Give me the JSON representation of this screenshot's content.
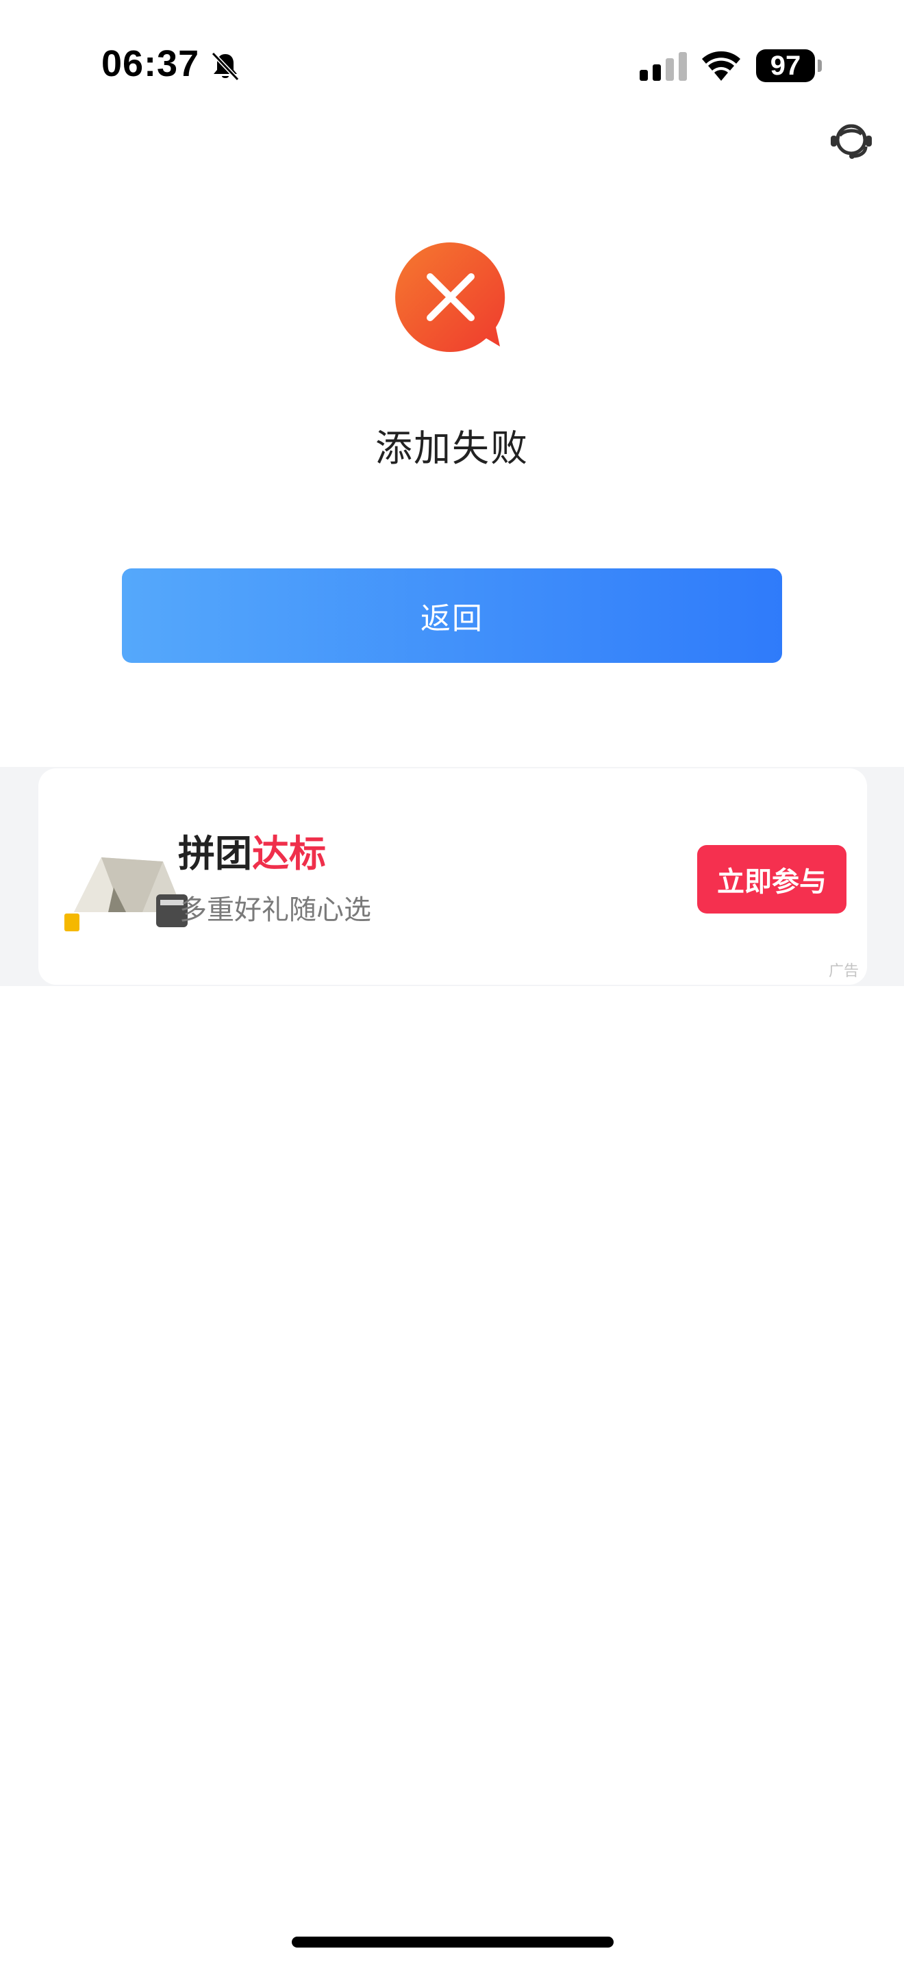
{
  "status_bar": {
    "time": "06:37",
    "battery": "97",
    "icons": [
      "bell-mute-icon",
      "signal-icon",
      "wifi-icon",
      "battery-icon"
    ]
  },
  "header": {
    "support_icon": "customer-service-icon"
  },
  "result": {
    "icon": "error-cross-bubble-icon",
    "title": "添加失败",
    "back_label": "返回"
  },
  "ad": {
    "title_main": "拼团",
    "title_highlight": "达标",
    "subtitle": "多重好礼随心选",
    "cta_label": "立即参与",
    "badge": "广告",
    "image": "tent-product-image"
  },
  "colors": {
    "accent_blue_start": "#55a8fb",
    "accent_blue_end": "#2f7bfa",
    "error_orange": "#f25a2c",
    "promo_red": "#f5304f"
  }
}
